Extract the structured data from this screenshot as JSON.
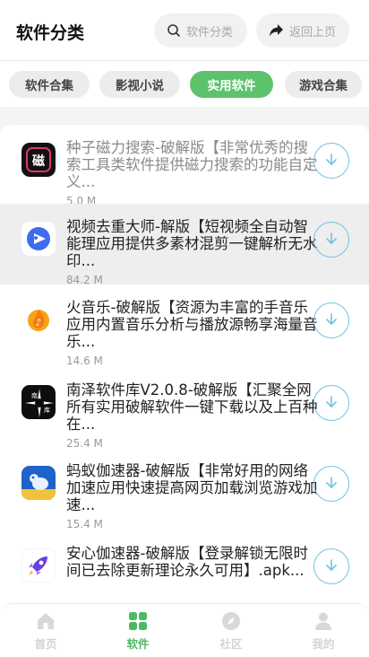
{
  "header": {
    "title": "软件分类",
    "search_label": "软件分类",
    "back_label": "返回上页"
  },
  "tabs": [
    {
      "label": "软件合集",
      "active": false
    },
    {
      "label": "影视小说",
      "active": false
    },
    {
      "label": "实用软件",
      "active": true
    },
    {
      "label": "游戏合集",
      "active": false
    }
  ],
  "apps": [
    {
      "title": "种子磁力搜索-破解版【非常优秀的搜索工具类软件提供磁力搜索的功能自定义...",
      "size": "5.0 M",
      "icon": "magnet-search-app-icon"
    },
    {
      "title": "视频去重大师-解版【短视频全自动智能理应用提供多素材混剪一键解析无水印...",
      "size": "84.2 M",
      "icon": "video-dedupe-app-icon"
    },
    {
      "title": "火音乐-破解版【资源为丰富的手音乐应用内置音乐分析与播放源畅享海量音乐...",
      "size": "14.6 M",
      "icon": "fire-music-app-icon"
    },
    {
      "title": "南泽软件库V2.0.8-破解版【汇聚全网所有实用破解软件一键下载以及上百种在...",
      "size": "25.4 M",
      "icon": "nanze-library-app-icon"
    },
    {
      "title": "蚂蚁伽速器-破解版【非常好用的网络加速应用快速提高网页加载浏览游戏加速...",
      "size": "15.4 M",
      "icon": "ant-accelerator-app-icon"
    },
    {
      "title": "安心伽速器-破解版【登录解锁无限时间已去除更新理论永久可用】.apk...",
      "size": "",
      "icon": "rocket-accelerator-app-icon"
    }
  ],
  "bottom_nav": [
    {
      "label": "首页",
      "icon": "home-icon",
      "active": false
    },
    {
      "label": "软件",
      "icon": "apps-grid-icon",
      "active": true
    },
    {
      "label": "社区",
      "icon": "compass-icon",
      "active": false
    },
    {
      "label": "我的",
      "icon": "user-icon",
      "active": false
    }
  ],
  "colors": {
    "accent": "#5ec26d",
    "download": "#6cc4e4"
  }
}
